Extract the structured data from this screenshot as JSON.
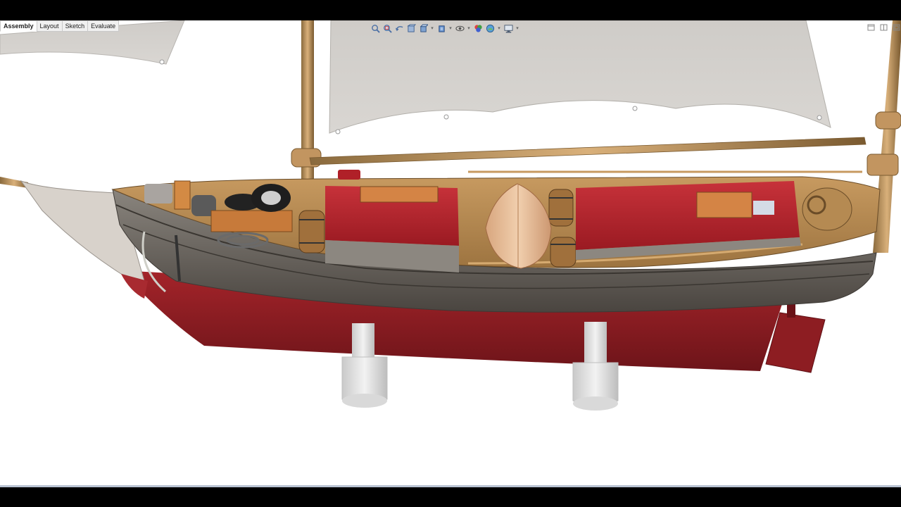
{
  "tabs": [
    {
      "label": "Assembly",
      "active": true
    },
    {
      "label": "Layout",
      "active": false
    },
    {
      "label": "Sketch",
      "active": false
    },
    {
      "label": "Evaluate",
      "active": false
    }
  ],
  "heads_up_toolbar": [
    "zoom-to-fit-icon",
    "zoom-to-area-icon",
    "previous-view-icon",
    "section-view-icon",
    "view-orientation-icon",
    "display-style-icon",
    "hide-show-items-icon",
    "edit-appearance-icon",
    "apply-scene-icon",
    "view-settings-icon"
  ],
  "window_controls": [
    "restore-icon",
    "tile-icon",
    "maximize-icon"
  ],
  "scene": {
    "subject": "schooner-3d-model",
    "colors": {
      "hull_bottom": "#8d1d22",
      "hull_topsides": "#6f6a64",
      "deck": "#b58a52",
      "covers": "#b8232b",
      "sail": "#d3d0cc",
      "spars": "#c99a5c",
      "stands": "#e2e2e2"
    }
  }
}
